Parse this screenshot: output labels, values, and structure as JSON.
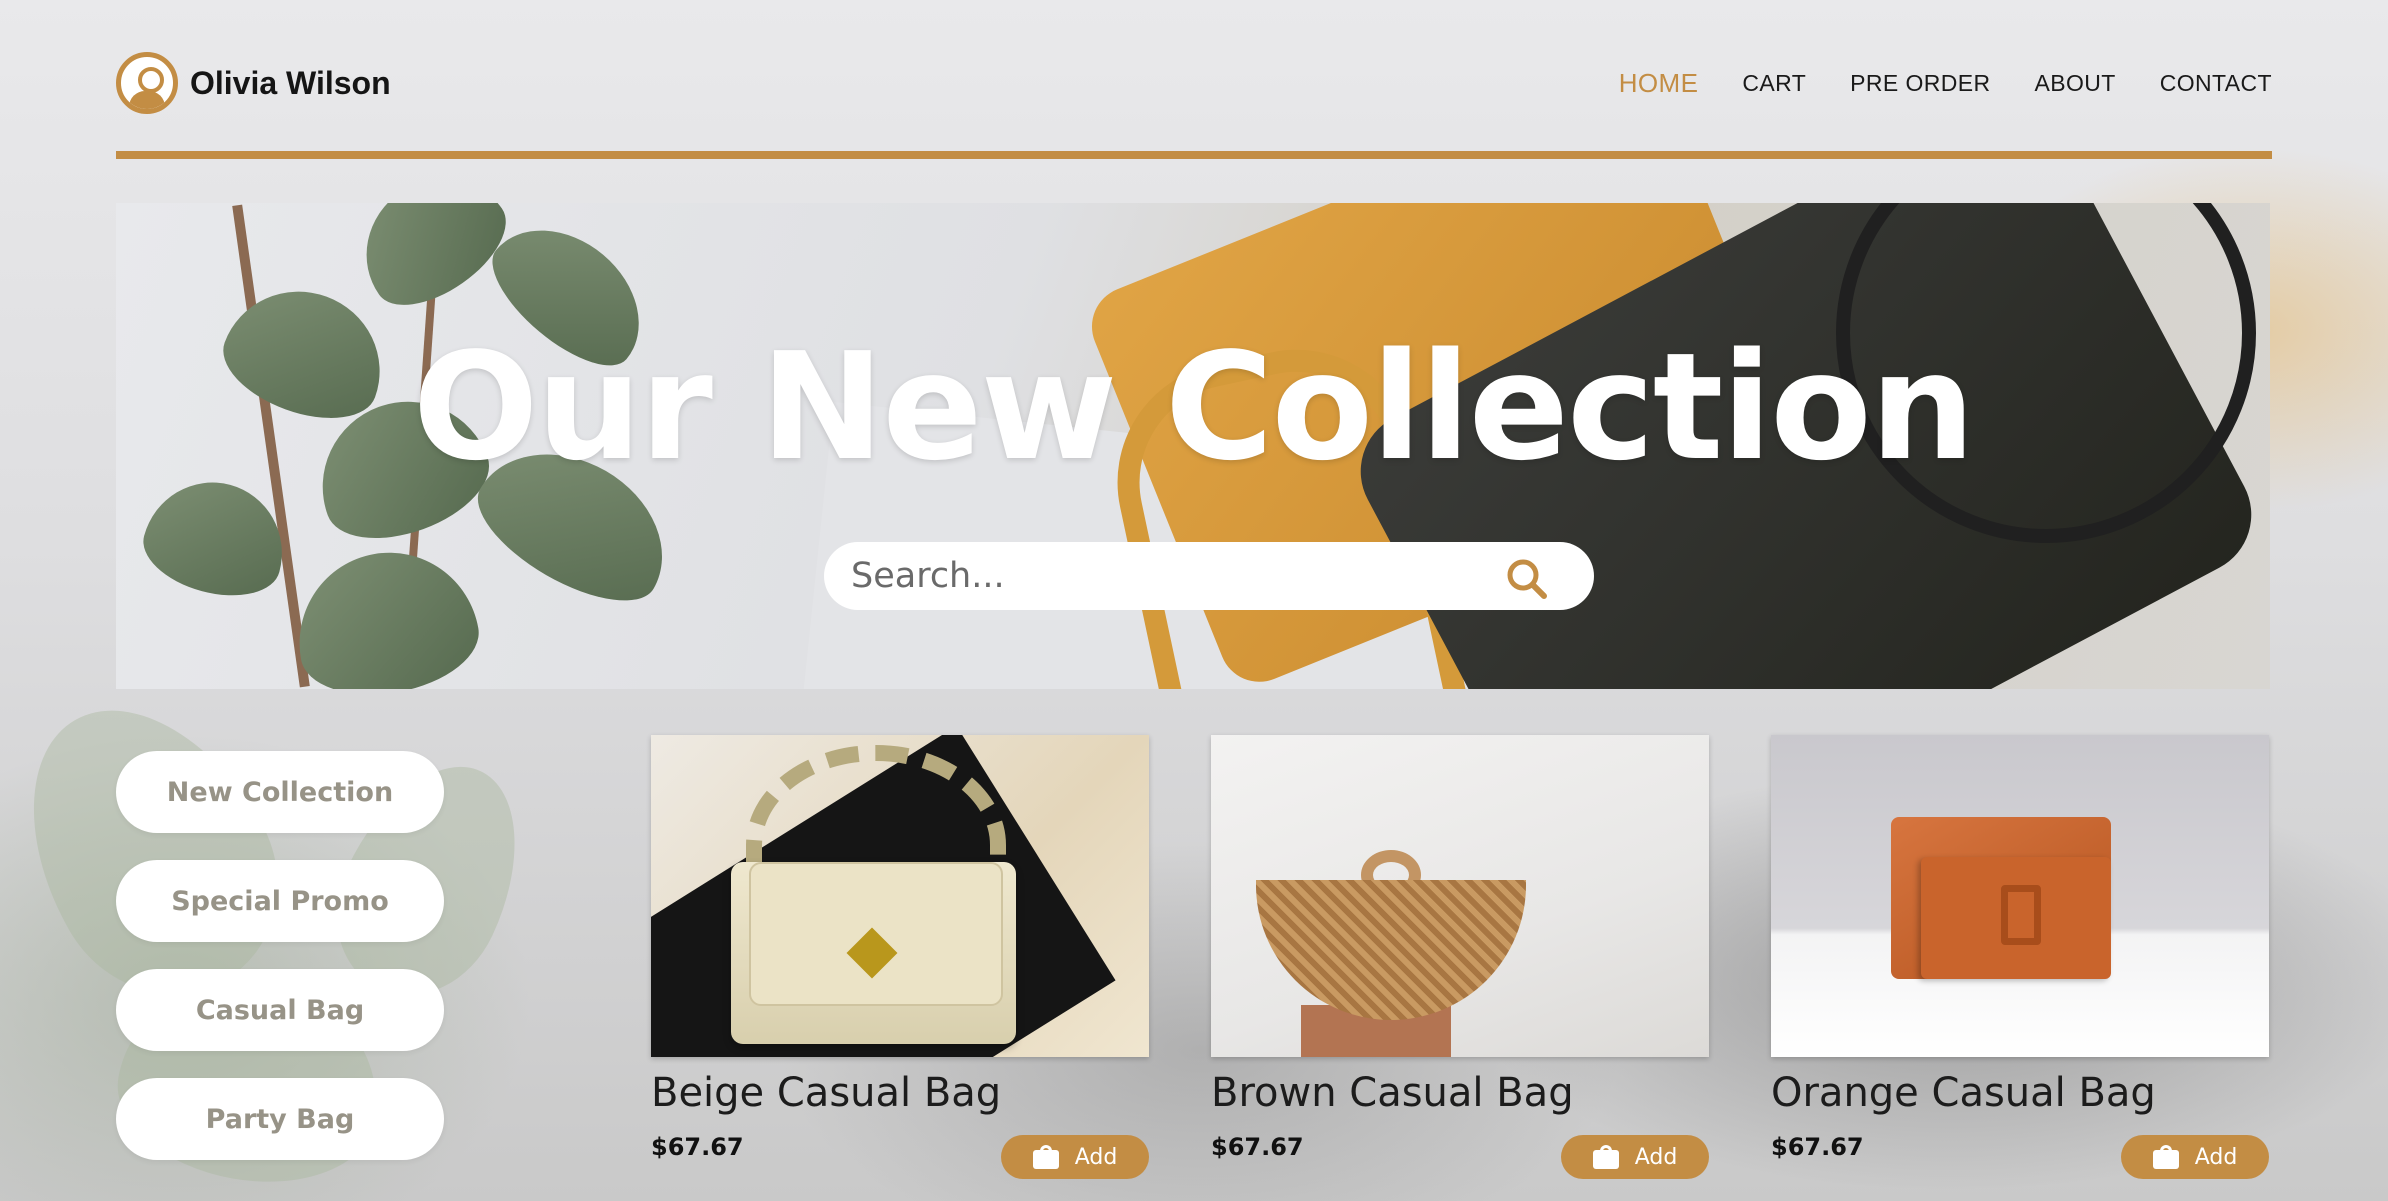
{
  "brand": {
    "name": "Olivia Wilson",
    "logo_icon": "user-circle-icon",
    "accent_color": "#c38d44"
  },
  "nav": {
    "items": [
      {
        "label": "HOME",
        "active": true
      },
      {
        "label": "CART",
        "active": false
      },
      {
        "label": "PRE ORDER",
        "active": false
      },
      {
        "label": "ABOUT",
        "active": false
      },
      {
        "label": "CONTACT",
        "active": false
      }
    ]
  },
  "hero": {
    "title": "Our New Collection",
    "search": {
      "placeholder": "Search...",
      "value": "",
      "icon": "search-icon"
    }
  },
  "sidebar": {
    "items": [
      {
        "label": "New Collection"
      },
      {
        "label": "Special Promo"
      },
      {
        "label": "Casual Bag"
      },
      {
        "label": "Party Bag"
      }
    ]
  },
  "products": [
    {
      "name": "Beige Casual Bag",
      "price": "$67.67",
      "add_label": "Add",
      "add_icon": "shopping-bag-icon"
    },
    {
      "name": "Brown Casual Bag",
      "price": "$67.67",
      "add_label": "Add",
      "add_icon": "shopping-bag-icon"
    },
    {
      "name": "Orange Casual Bag",
      "price": "$67.67",
      "add_label": "Add",
      "add_icon": "shopping-bag-icon"
    }
  ]
}
